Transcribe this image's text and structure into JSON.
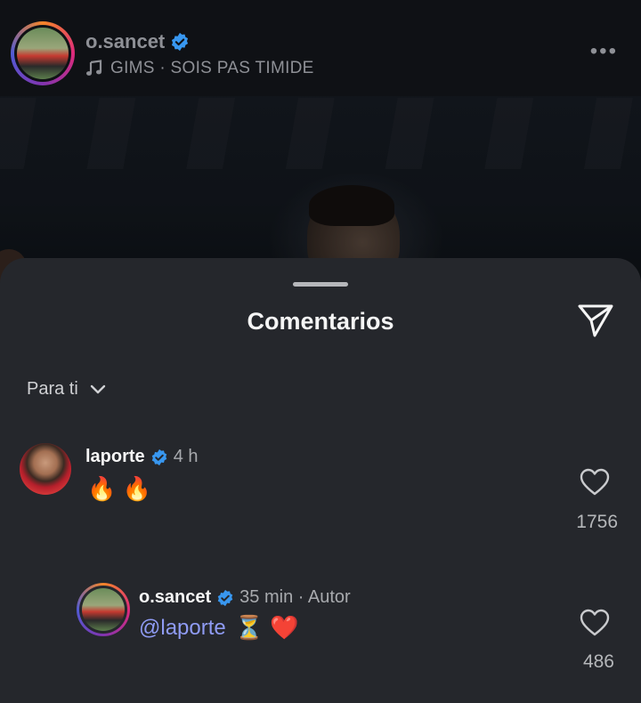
{
  "header": {
    "username": "o.sancet",
    "music": "GIMS · SOIS PAS TIMIDE"
  },
  "sheet": {
    "title": "Comentarios",
    "filter_label": "Para ti"
  },
  "comments": [
    {
      "username": "laporte",
      "time": "4 h",
      "text": "🔥 🔥",
      "likes": "1756"
    },
    {
      "username": "o.sancet",
      "time": "35 min · Autor",
      "mention": "@laporte",
      "text": "⏳ ❤️",
      "likes": "486"
    }
  ],
  "colors": {
    "sheet_bg": "#25272c",
    "verified": "#3897f0",
    "mention": "#8f9bf4"
  }
}
